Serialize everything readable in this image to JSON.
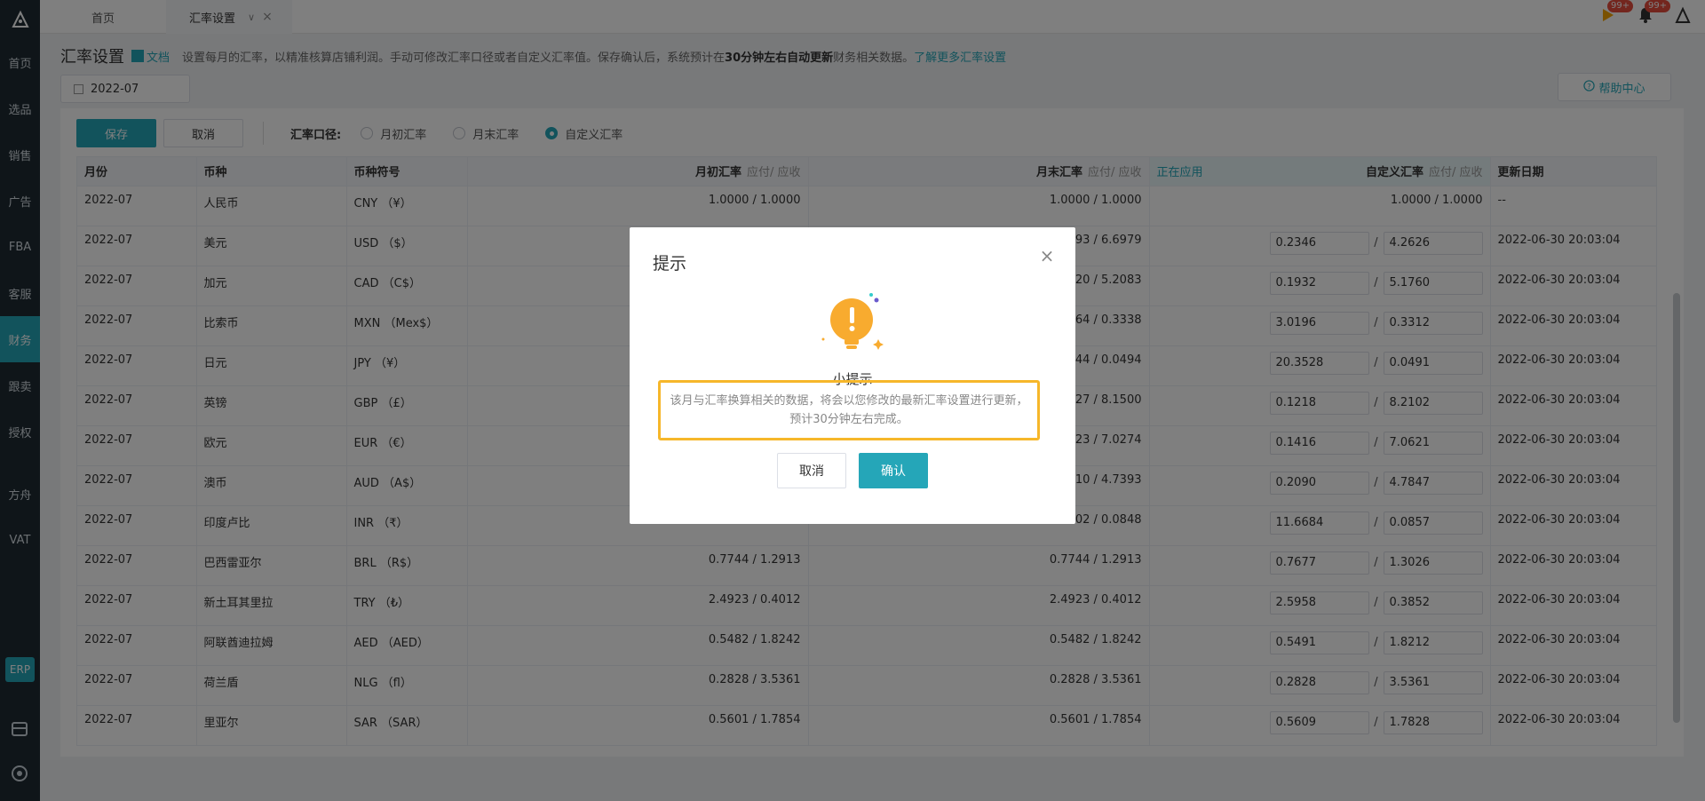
{
  "sidebar": {
    "items": [
      {
        "label": "首页"
      },
      {
        "label": "选品"
      },
      {
        "label": "销售"
      },
      {
        "label": "广告"
      },
      {
        "label": "FBA"
      },
      {
        "label": "客服"
      },
      {
        "label": "财务",
        "active": true
      },
      {
        "label": "跟卖"
      },
      {
        "label": "授权"
      },
      {
        "label": "方舟"
      },
      {
        "label": "VAT"
      }
    ],
    "erp": "ERP"
  },
  "tabs": {
    "home": "首页",
    "rate": "汇率设置",
    "arrow": "∨",
    "close": "×"
  },
  "top": {
    "flag_badge": "99+",
    "bell_badge": "99+"
  },
  "header": {
    "title": "汇率设置",
    "doc": "文档",
    "desc_a": "设置每月的汇率，以精准核算店铺利润。手动可修改汇率口径或者自定义汇率值。保存确认后，系统预计在",
    "desc_b": "30分钟左右自动更新",
    "desc_c": "财务相关数据。",
    "learn_more": "了解更多汇率设置"
  },
  "month": "2022-07",
  "help": "帮助中心",
  "toolbar": {
    "save": "保存",
    "cancel": "取消",
    "basis_label": "汇率口径:",
    "options": [
      "月初汇率",
      "月末汇率",
      "自定义汇率"
    ],
    "selected": 2
  },
  "table": {
    "headers": {
      "month": "月份",
      "currency": "币种",
      "symbol": "币种符号",
      "begin": "月初汇率",
      "end": "月末汇率",
      "custom": "自定义汇率",
      "sub": "应付/ 应收",
      "applying": "正在应用",
      "updated": "更新日期"
    },
    "rows": [
      {
        "month": "2022-07",
        "currency": "人民币",
        "symbol": "CNY （¥）",
        "begin": "1.0000 / 1.0000",
        "end": "1.0000 / 1.0000",
        "custom_text": "1.0000 / 1.0000",
        "updated": "--"
      },
      {
        "month": "2022-07",
        "currency": "美元",
        "symbol": "USD （$）",
        "begin": "",
        "end": "93 / 6.6979",
        "c1": "0.2346",
        "c2": "4.2626",
        "updated": "2022-06-30 20:03:04"
      },
      {
        "month": "2022-07",
        "currency": "加元",
        "symbol": "CAD （C$）",
        "begin": "",
        "end": "20 / 5.2083",
        "c1": "0.1932",
        "c2": "5.1760",
        "updated": "2022-06-30 20:03:04"
      },
      {
        "month": "2022-07",
        "currency": "比索币",
        "symbol": "MXN （Mex$）",
        "begin": "",
        "end": "64 / 0.3338",
        "c1": "3.0196",
        "c2": "0.3312",
        "updated": "2022-06-30 20:03:04"
      },
      {
        "month": "2022-07",
        "currency": "日元",
        "symbol": "JPY （¥）",
        "begin": "",
        "end": "44 / 0.0494",
        "c1": "20.3528",
        "c2": "0.0491",
        "updated": "2022-06-30 20:03:04"
      },
      {
        "month": "2022-07",
        "currency": "英镑",
        "symbol": "GBP （£）",
        "begin": "",
        "end": "27 / 8.1500",
        "c1": "0.1218",
        "c2": "8.2102",
        "updated": "2022-06-30 20:03:04"
      },
      {
        "month": "2022-07",
        "currency": "欧元",
        "symbol": "EUR （€）",
        "begin": "",
        "end": "23 / 7.0274",
        "c1": "0.1416",
        "c2": "7.0621",
        "updated": "2022-06-30 20:03:04"
      },
      {
        "month": "2022-07",
        "currency": "澳币",
        "symbol": "AUD （A$）",
        "begin": "",
        "end": "10 / 4.7393",
        "c1": "0.2090",
        "c2": "4.7847",
        "updated": "2022-06-30 20:03:04"
      },
      {
        "month": "2022-07",
        "currency": "印度卢比",
        "symbol": "INR （₹）",
        "begin": "",
        "end": "02 / 0.0848",
        "c1": "11.6684",
        "c2": "0.0857",
        "updated": "2022-06-30 20:03:04"
      },
      {
        "month": "2022-07",
        "currency": "巴西雷亚尔",
        "symbol": "BRL （R$）",
        "begin": "0.7744  /  1.2913",
        "end": "0.7744 / 1.2913",
        "c1": "0.7677",
        "c2": "1.3026",
        "updated": "2022-06-30 20:03:04"
      },
      {
        "month": "2022-07",
        "currency": "新土耳其里拉",
        "symbol": "TRY （₺）",
        "begin": "2.4923  /  0.4012",
        "end": "2.4923 / 0.4012",
        "c1": "2.5958",
        "c2": "0.3852",
        "updated": "2022-06-30 20:03:04"
      },
      {
        "month": "2022-07",
        "currency": "阿联酋迪拉姆",
        "symbol": "AED （AED）",
        "begin": "0.5482  /  1.8242",
        "end": "0.5482 / 1.8242",
        "c1": "0.5491",
        "c2": "1.8212",
        "updated": "2022-06-30 20:03:04"
      },
      {
        "month": "2022-07",
        "currency": "荷兰盾",
        "symbol": "NLG （fl）",
        "begin": "0.2828  /  3.5361",
        "end": "0.2828 / 3.5361",
        "c1": "0.2828",
        "c2": "3.5361",
        "updated": "2022-06-30 20:03:04"
      },
      {
        "month": "2022-07",
        "currency": "里亚尔",
        "symbol": "SAR （SAR）",
        "begin": "0.5601  /  1.7854",
        "end": "0.5601 / 1.7854",
        "c1": "0.5609",
        "c2": "1.7828",
        "updated": "2022-06-30 20:03:04"
      }
    ]
  },
  "modal": {
    "title": "提示",
    "close": "×",
    "subtitle": "小提示",
    "message": "该月与汇率换算相关的数据，将会以您修改的最新汇率设置进行更新，预计30分钟左右完成。",
    "cancel": "取消",
    "confirm": "确认"
  },
  "colors": {
    "accent": "#25a6b8",
    "warning": "#f6b72a",
    "sidebar": "#1e2a33"
  }
}
